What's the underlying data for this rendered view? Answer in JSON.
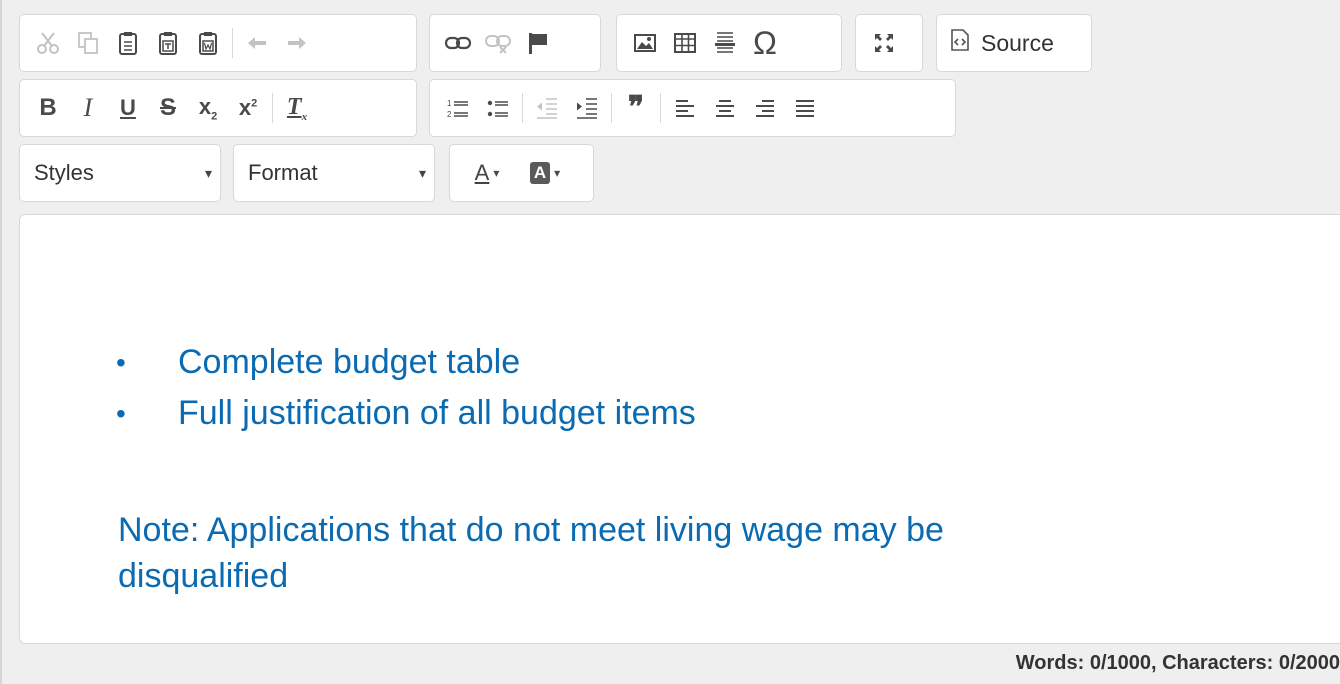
{
  "toolbar": {
    "clipboard_group": [
      "scissors-icon",
      "copy-icon",
      "paste-icon",
      "paste-text-icon",
      "paste-word-icon",
      "undo-icon",
      "redo-icon"
    ],
    "link_group": [
      "link-icon",
      "unlink-icon",
      "anchor-icon"
    ],
    "insert_group": [
      "image-icon",
      "table-icon",
      "horizontal-line-icon",
      "special-char-icon"
    ],
    "maximize_icon": "maximize-icon",
    "source_label": "Source",
    "omega_glyph": "Ω",
    "styles_label": "Styles",
    "format_label": "Format",
    "combo_arrow": "▾",
    "blockquote_glyph": "❞",
    "text_color_letter": "A",
    "bg_color_letter": "A"
  },
  "content": {
    "bullet_char": "•",
    "bullets": [
      "Complete budget table",
      "Full justification of all budget items"
    ],
    "note": "Note: Applications that do not meet living wage may be disqualified",
    "text_color": "#0a6bb3"
  },
  "status": {
    "counter": "Words: 0/1000, Characters: 0/2000"
  }
}
